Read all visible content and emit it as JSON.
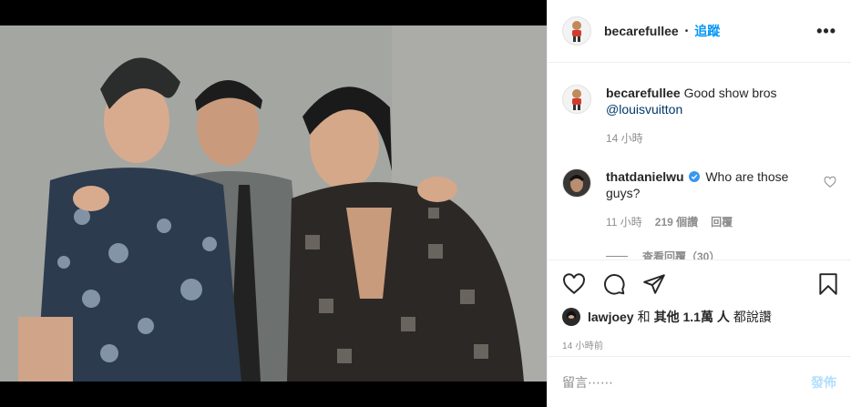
{
  "header": {
    "username": "becarefullee",
    "separator": "•",
    "follow_label": "追蹤",
    "more_label": "•••"
  },
  "caption": {
    "username": "becarefullee",
    "text": "Good show bros",
    "mention": "@louisvuitton",
    "time": "14 小時"
  },
  "comment": {
    "username": "thatdanielwu",
    "text": "Who are those guys?",
    "time": "11 小時",
    "likes": "219 個讚",
    "reply_label": "回覆"
  },
  "view_replies": "查看回覆（30）",
  "likes": {
    "user": "lawjoey",
    "and": "和",
    "others": "其他 1.1萬 人",
    "suffix": "都說讚"
  },
  "post_time": "14 小時前",
  "add_comment": {
    "placeholder": "留言⋯⋯",
    "post_label": "發佈"
  },
  "colors": {
    "accent": "#0095f6",
    "post_disabled": "#b2dffc",
    "muted": "#8e8e8e"
  },
  "icons": [
    "heart-icon",
    "comment-icon",
    "share-icon",
    "bookmark-icon",
    "verified-icon",
    "more-icon"
  ]
}
